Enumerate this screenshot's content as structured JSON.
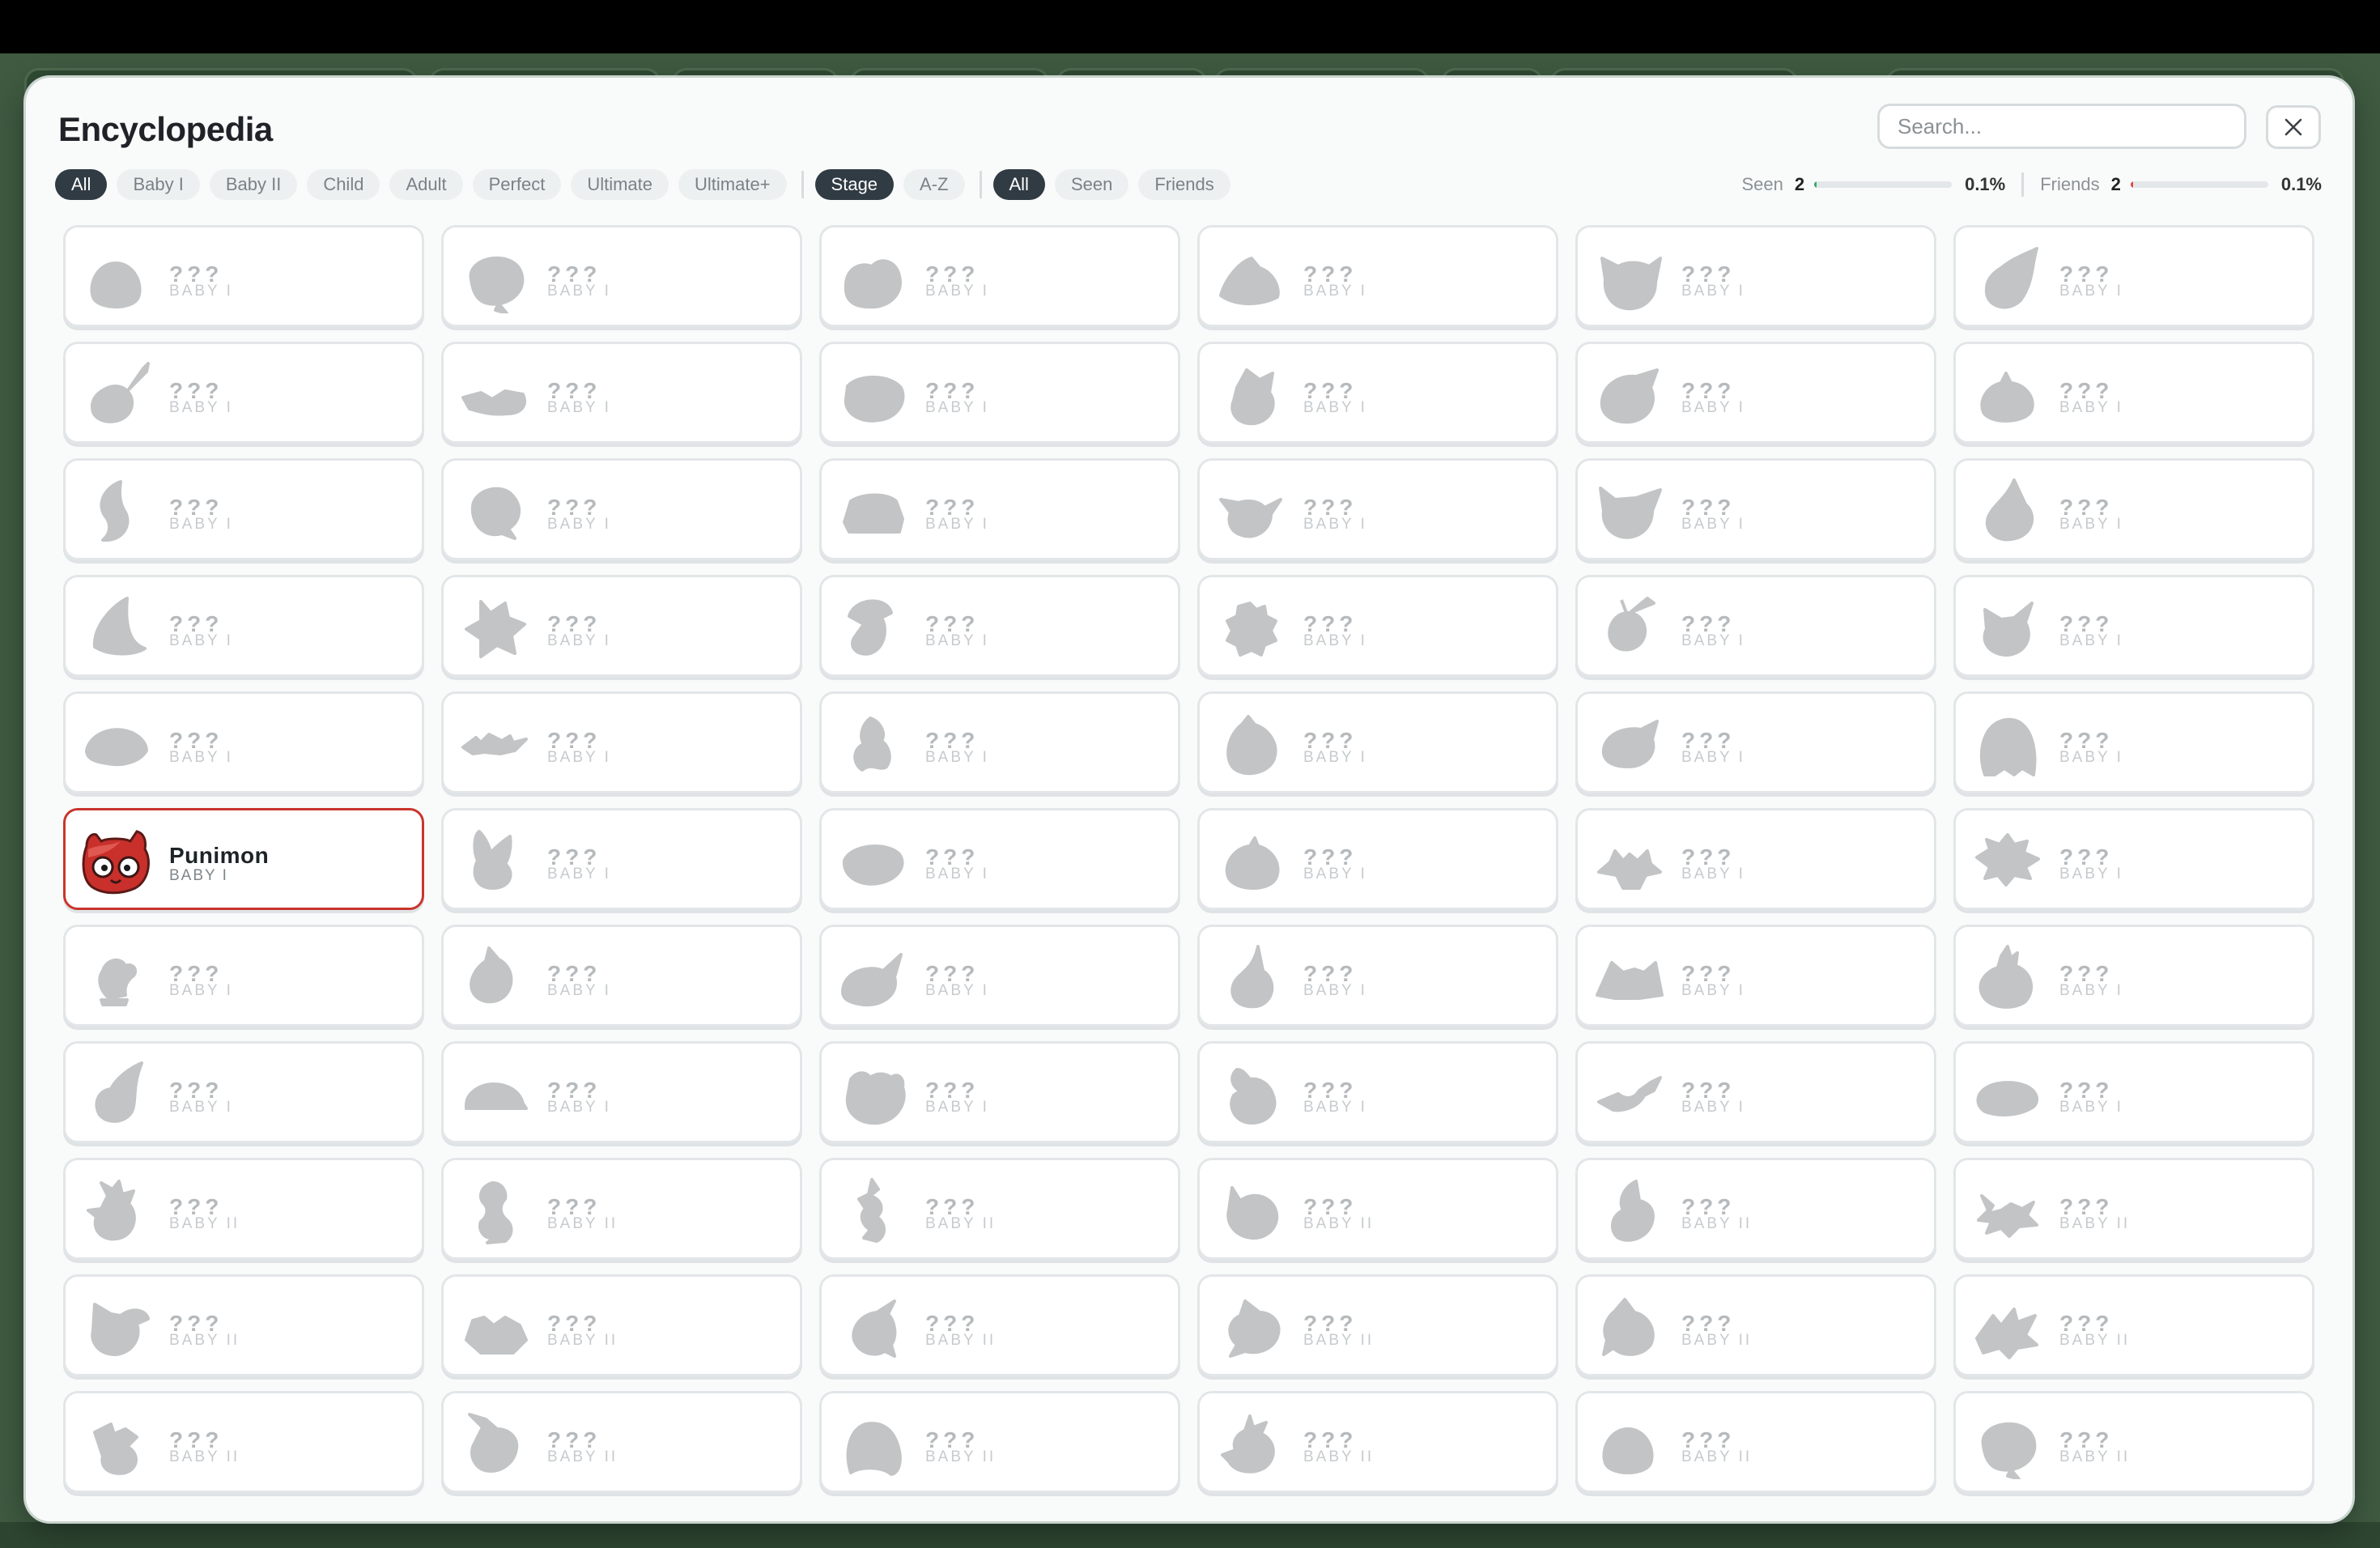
{
  "modal": {
    "title": "Encyclopedia",
    "search_placeholder": "Search...",
    "close_icon": "close-icon"
  },
  "filters": {
    "stages": [
      {
        "label": "All",
        "active": true
      },
      {
        "label": "Baby I",
        "active": false
      },
      {
        "label": "Baby II",
        "active": false
      },
      {
        "label": "Child",
        "active": false
      },
      {
        "label": "Adult",
        "active": false
      },
      {
        "label": "Perfect",
        "active": false
      },
      {
        "label": "Ultimate",
        "active": false
      },
      {
        "label": "Ultimate+",
        "active": false
      }
    ],
    "sort": [
      {
        "label": "Stage",
        "active": true
      },
      {
        "label": "A-Z",
        "active": false
      }
    ],
    "show": [
      {
        "label": "All",
        "active": true
      },
      {
        "label": "Seen",
        "active": false
      },
      {
        "label": "Friends",
        "active": false
      }
    ]
  },
  "stats": {
    "seen": {
      "label": "Seen",
      "count": "2",
      "percent_text": "0.1%",
      "fraction": 0.001,
      "color": "#3aa76d"
    },
    "friends": {
      "label": "Friends",
      "count": "2",
      "percent_text": "0.1%",
      "fraction": 0.001,
      "color": "#e0483e"
    }
  },
  "colors": {
    "silhouette": "#c2c4c6",
    "accent": "#c9352c"
  },
  "entries": [
    {
      "name": "???",
      "stage": "BABY I"
    },
    {
      "name": "???",
      "stage": "BABY I"
    },
    {
      "name": "???",
      "stage": "BABY I"
    },
    {
      "name": "???",
      "stage": "BABY I"
    },
    {
      "name": "???",
      "stage": "BABY I"
    },
    {
      "name": "???",
      "stage": "BABY I"
    },
    {
      "name": "???",
      "stage": "BABY I"
    },
    {
      "name": "???",
      "stage": "BABY I"
    },
    {
      "name": "???",
      "stage": "BABY I"
    },
    {
      "name": "???",
      "stage": "BABY I"
    },
    {
      "name": "???",
      "stage": "BABY I"
    },
    {
      "name": "???",
      "stage": "BABY I"
    },
    {
      "name": "???",
      "stage": "BABY I"
    },
    {
      "name": "???",
      "stage": "BABY I"
    },
    {
      "name": "???",
      "stage": "BABY I"
    },
    {
      "name": "???",
      "stage": "BABY I"
    },
    {
      "name": "???",
      "stage": "BABY I"
    },
    {
      "name": "???",
      "stage": "BABY I"
    },
    {
      "name": "???",
      "stage": "BABY I"
    },
    {
      "name": "???",
      "stage": "BABY I"
    },
    {
      "name": "???",
      "stage": "BABY I"
    },
    {
      "name": "???",
      "stage": "BABY I"
    },
    {
      "name": "???",
      "stage": "BABY I"
    },
    {
      "name": "???",
      "stage": "BABY I"
    },
    {
      "name": "???",
      "stage": "BABY I"
    },
    {
      "name": "???",
      "stage": "BABY I"
    },
    {
      "name": "???",
      "stage": "BABY I"
    },
    {
      "name": "???",
      "stage": "BABY I"
    },
    {
      "name": "???",
      "stage": "BABY I"
    },
    {
      "name": "???",
      "stage": "BABY I"
    },
    {
      "name": "Punimon",
      "stage": "BABY I",
      "found": true
    },
    {
      "name": "???",
      "stage": "BABY I"
    },
    {
      "name": "???",
      "stage": "BABY I"
    },
    {
      "name": "???",
      "stage": "BABY I"
    },
    {
      "name": "???",
      "stage": "BABY I"
    },
    {
      "name": "???",
      "stage": "BABY I"
    },
    {
      "name": "???",
      "stage": "BABY I"
    },
    {
      "name": "???",
      "stage": "BABY I"
    },
    {
      "name": "???",
      "stage": "BABY I"
    },
    {
      "name": "???",
      "stage": "BABY I"
    },
    {
      "name": "???",
      "stage": "BABY I"
    },
    {
      "name": "???",
      "stage": "BABY I"
    },
    {
      "name": "???",
      "stage": "BABY I"
    },
    {
      "name": "???",
      "stage": "BABY I"
    },
    {
      "name": "???",
      "stage": "BABY I"
    },
    {
      "name": "???",
      "stage": "BABY I"
    },
    {
      "name": "???",
      "stage": "BABY I"
    },
    {
      "name": "???",
      "stage": "BABY I"
    },
    {
      "name": "???",
      "stage": "BABY II"
    },
    {
      "name": "???",
      "stage": "BABY II"
    },
    {
      "name": "???",
      "stage": "BABY II"
    },
    {
      "name": "???",
      "stage": "BABY II"
    },
    {
      "name": "???",
      "stage": "BABY II"
    },
    {
      "name": "???",
      "stage": "BABY II"
    },
    {
      "name": "???",
      "stage": "BABY II"
    },
    {
      "name": "???",
      "stage": "BABY II"
    },
    {
      "name": "???",
      "stage": "BABY II"
    },
    {
      "name": "???",
      "stage": "BABY II"
    },
    {
      "name": "???",
      "stage": "BABY II"
    },
    {
      "name": "???",
      "stage": "BABY II"
    },
    {
      "name": "???",
      "stage": "BABY II"
    },
    {
      "name": "???",
      "stage": "BABY II"
    },
    {
      "name": "???",
      "stage": "BABY II"
    },
    {
      "name": "???",
      "stage": "BABY II"
    },
    {
      "name": "???",
      "stage": "BABY II"
    },
    {
      "name": "???",
      "stage": "BABY II"
    }
  ]
}
